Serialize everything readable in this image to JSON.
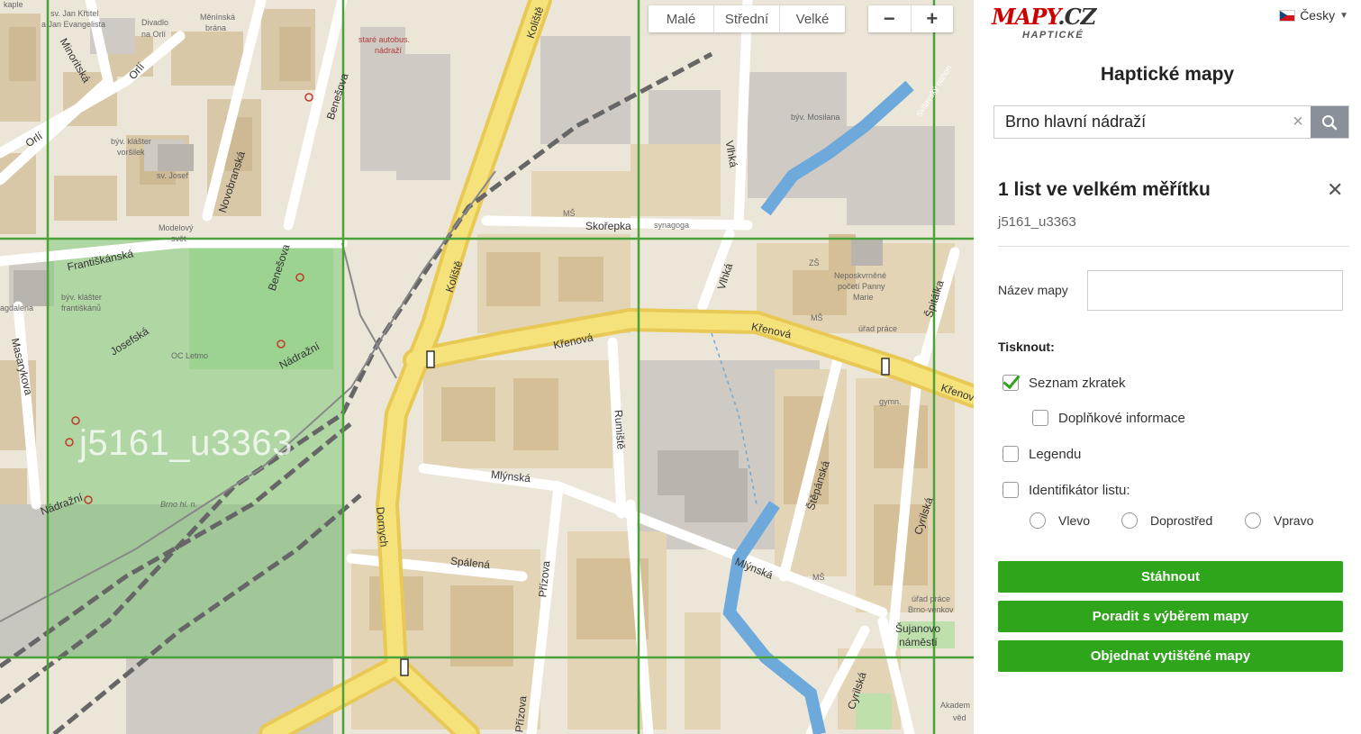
{
  "map": {
    "size_options": [
      "Malé",
      "Střední",
      "Velké"
    ],
    "zoom_out": "−",
    "zoom_in": "+",
    "sheet_overlay_label": "j5161_u3363",
    "labels": {
      "kaple": "kaple",
      "sv_jan": "sv. Jan Křtitel",
      "sv_jan2": "a Jan Evangelista",
      "divadlo": "Divadlo",
      "divadlo2": "na Orlí",
      "menin": "Měnínská",
      "menin2": "brána",
      "stare_nadrazi": "staré autobus.",
      "stare_nadrazi2": "nádraží",
      "klaster_vorsilek": "býv. klášter",
      "klaster_vorsilek2": "voršilek",
      "sv_josef": "sv. Josef",
      "modelovy": "Modelový",
      "modelovy2": "svět",
      "klaster_fr": "býv. klášter",
      "klaster_fr2": "františkánů",
      "oc_letmo": "OC Letmo",
      "brno_hl": "Brno hl. n.",
      "mosilana": "býv. Mosilana",
      "synagoga": "synagoga",
      "neposkvrnene": "Neposkvrněné",
      "neposkvrnene2": "početí Panny",
      "neposkvrnene3": "Marie",
      "urad_prace": "úřad práce",
      "gymn": "gymn.",
      "urad_prace2": "úřad práce",
      "urad_prace3": "Brno-venkov",
      "sujanovo": "Šujanovo",
      "sujanovo2": "náměstí",
      "akadem": "Akadem",
      "akadem2": "věd",
      "magdalena": "agdalena"
    },
    "streets": {
      "orli": "Orlí",
      "orli2": "Orlí",
      "minoritska": "Minoritská",
      "novobranska": "Novobranská",
      "benesova": "Benešova",
      "benesova2": "Benešova",
      "frantiskanska": "Františkánská",
      "josefska": "Josefská",
      "masarykova": "Masarykova",
      "nadrazni": "Nádražní",
      "nadrazni2": "Nádražní",
      "kolistee": "Koliště",
      "kolistee2": "Koliště",
      "skorepka": "Skořepka",
      "vlhka": "Vlhká",
      "vlhka2": "Vlhká",
      "krenova": "Křenová",
      "krenova2": "Křenová",
      "krenova3": "Křenova",
      "rumiste": "Rumiště",
      "mlynska": "Mlýnská",
      "mlynska2": "Mlýnská",
      "dornych": "Dornych",
      "spalena": "Spálená",
      "prizova": "Přízova",
      "prizova2": "Přízova",
      "stepanska": "Štěpánská",
      "cyrilska": "Cyrilská",
      "cyrilska2": "Cyrilská",
      "spitalka": "Špitálka",
      "svitavsky": "Svitavský náhon",
      "ms": "MŠ",
      "zs": "ZŠ"
    }
  },
  "panel": {
    "logo_main": "MAPY",
    "logo_cz": ".CZ",
    "logo_sub": "HAPTICKÉ",
    "language": "Česky",
    "title": "Haptické mapy",
    "search_value": "Brno hlavní nádraží",
    "section_title": "1 list ve velkém měřítku",
    "section_subtitle": "j5161_u3363",
    "name_label": "Název mapy",
    "name_value": "",
    "print_label": "Tisknout:",
    "options": {
      "seznam": "Seznam zkratek",
      "doplnkove": "Doplňkové informace",
      "legendu": "Legendu",
      "identifikator": "Identifikátor listu:"
    },
    "positions": [
      "Vlevo",
      "Doprostřed",
      "Vpravo"
    ],
    "buttons": {
      "download": "Stáhnout",
      "advise": "Poradit s výběrem mapy",
      "order": "Objednat vytištěné mapy"
    },
    "checked": {
      "seznam": true,
      "doplnkove": false,
      "legendu": false,
      "identifikator": false
    }
  }
}
